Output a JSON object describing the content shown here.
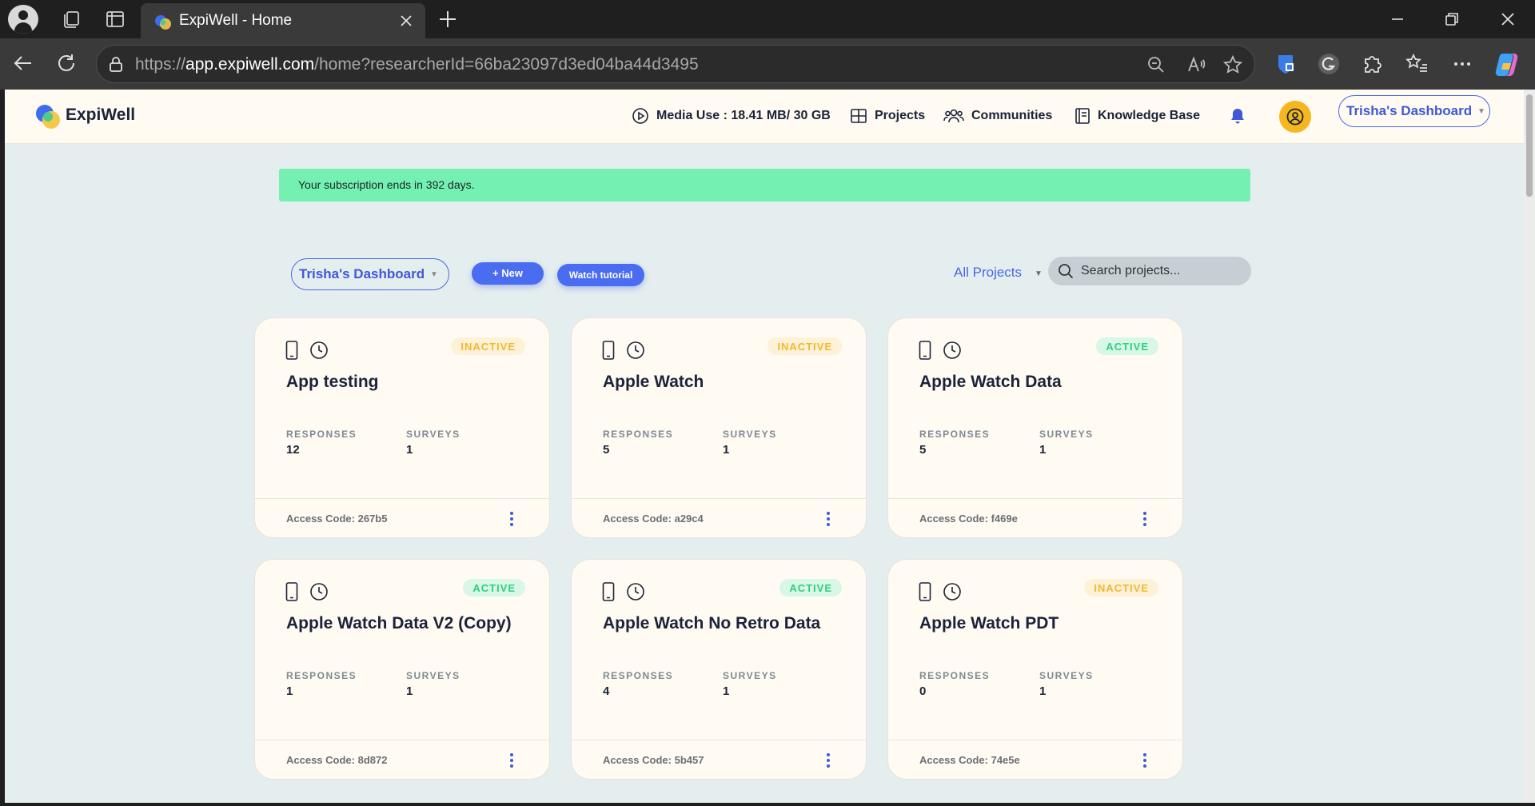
{
  "browser": {
    "tab_title": "ExpiWell - Home",
    "url_scheme": "https://",
    "url_host": "app.expiwell.com",
    "url_path": "/home?researcherId=66ba23097d3ed04ba44d3495"
  },
  "header": {
    "brand": "ExpiWell",
    "media_use": "Media Use : 18.41 MB/ 30 GB",
    "projects": "Projects",
    "communities": "Communities",
    "knowledge_base": "Knowledge Base",
    "dashboard_button": "Trisha's Dashboard"
  },
  "banner": {
    "text": "Your subscription ends in 392 days."
  },
  "toolbar": {
    "dashboard_select": "Trisha's Dashboard",
    "new_label": "New",
    "tutorial_label": "Watch tutorial",
    "filter_label": "All Projects",
    "search_placeholder": "Search projects..."
  },
  "labels": {
    "responses": "RESPONSES",
    "surveys": "SURVEYS"
  },
  "colors": {
    "accent": "#4a6cf0",
    "active": "#2ecf7f",
    "inactive": "#f3b632",
    "banner": "#74f0b3"
  },
  "projects": [
    {
      "title": "App testing",
      "status": "INACTIVE",
      "responses": "12",
      "surveys": "1",
      "access_code": "Access Code: 267b5"
    },
    {
      "title": "Apple Watch",
      "status": "INACTIVE",
      "responses": "5",
      "surveys": "1",
      "access_code": "Access Code: a29c4"
    },
    {
      "title": "Apple Watch Data",
      "status": "ACTIVE",
      "responses": "5",
      "surveys": "1",
      "access_code": "Access Code: f469e"
    },
    {
      "title": "Apple Watch Data V2 (Copy)",
      "status": "ACTIVE",
      "responses": "1",
      "surveys": "1",
      "access_code": "Access Code: 8d872"
    },
    {
      "title": "Apple Watch No Retro Data",
      "status": "ACTIVE",
      "responses": "4",
      "surveys": "1",
      "access_code": "Access Code: 5b457"
    },
    {
      "title": "Apple Watch PDT",
      "status": "INACTIVE",
      "responses": "0",
      "surveys": "1",
      "access_code": "Access Code: 74e5e"
    }
  ]
}
